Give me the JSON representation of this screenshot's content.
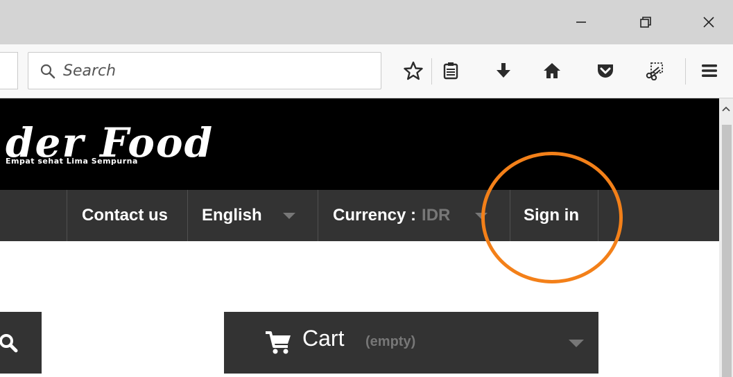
{
  "browser": {
    "search_placeholder": "Search",
    "window_controls": [
      "minimize-icon",
      "restore-icon",
      "close-icon"
    ],
    "toolbar_icons": [
      "bookmark-star-icon",
      "reading-list-icon",
      "download-icon",
      "home-icon",
      "pocket-icon",
      "screenshot-icon",
      "menu-icon"
    ]
  },
  "banner": {
    "logo_text": "der Food",
    "tagline": "Empat sehat Lima Sempurna"
  },
  "nav": {
    "contact": "Contact us",
    "language": "English",
    "currency_label": "Currency :",
    "currency_value": "IDR",
    "signin": "Sign in"
  },
  "cart": {
    "label": "Cart",
    "status": "(empty)"
  },
  "colors": {
    "nav_bg": "#333333",
    "highlight": "#f38019",
    "muted": "#777777"
  }
}
